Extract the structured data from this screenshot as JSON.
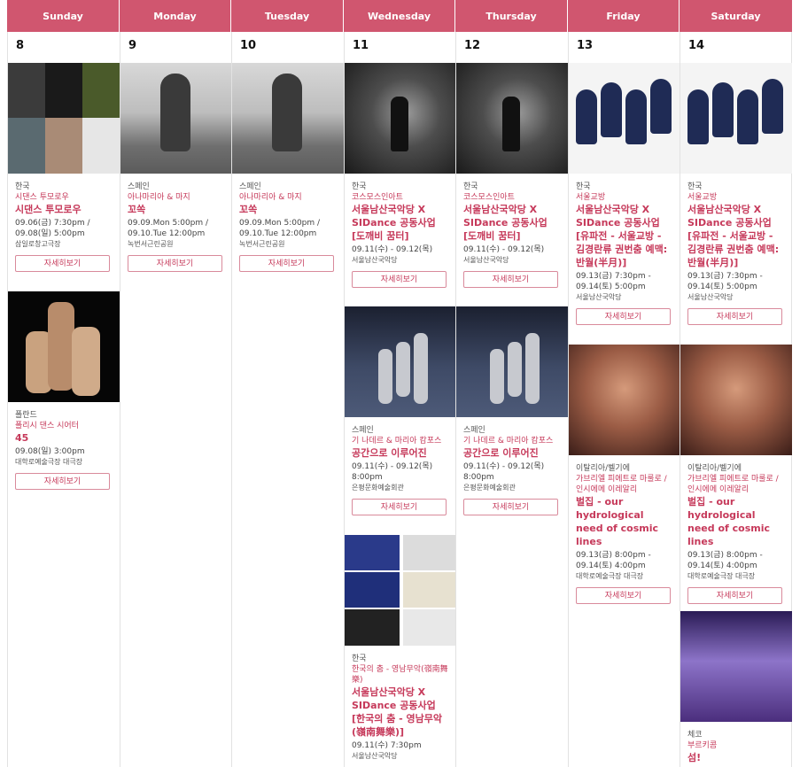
{
  "days": [
    {
      "name": "Sunday",
      "date": "8"
    },
    {
      "name": "Monday",
      "date": "9"
    },
    {
      "name": "Tuesday",
      "date": "10"
    },
    {
      "name": "Wednesday",
      "date": "11"
    },
    {
      "name": "Thursday",
      "date": "12"
    },
    {
      "name": "Friday",
      "date": "13"
    },
    {
      "name": "Saturday",
      "date": "14"
    }
  ],
  "button_label": "자세히보기",
  "events": {
    "sun1": {
      "country": "한국",
      "company": "시댄스 투모로우",
      "title": "시댄스 투모로우",
      "date": "09.06(금) 7:30pm / 09.08(일) 5:00pm",
      "venue": "삼일로창고극장"
    },
    "sun2": {
      "country": "폴란드",
      "company": "폴리시 댄스 시어터",
      "title": "45",
      "date": "09.08(일) 3:00pm",
      "venue": "대학로예술극장 대극장"
    },
    "mon1": {
      "country": "스페인",
      "company": "아나마리아 & 마지",
      "title": "꼬쏙",
      "date": "09.09.Mon 5:00pm / 09.10.Tue 12:00pm",
      "venue": "녹번서근린공원"
    },
    "tue1": {
      "country": "스페인",
      "company": "아나마리아 & 마지",
      "title": "꼬쏙",
      "date": "09.09.Mon 5:00pm / 09.10.Tue 12:00pm",
      "venue": "녹번서근린공원"
    },
    "wed1": {
      "country": "한국",
      "company": "코스모스인아트",
      "title": "서울남산국악당 X SIDance 공동사업 [도깨비 꿈터]",
      "date": "09.11(수) - 09.12(목)",
      "venue": "서울남산국악당"
    },
    "wed2": {
      "country": "스페인",
      "company": "기 나데르 & 마리아 캄포스",
      "title": "공간으로 이루어진",
      "date": "09.11(수) - 09.12(목) 8:00pm",
      "venue": "은평문화예술회관"
    },
    "wed3": {
      "country": "한국",
      "company": "한국의 춤 - 영남무악(嶺南舞樂)",
      "title": "서울남산국악당 X SIDance 공동사업 [한국의 춤 - 영남무악(嶺南舞樂)]",
      "date": "09.11(수) 7:30pm",
      "venue": "서울남산국악당"
    },
    "thu1": {
      "country": "한국",
      "company": "코스모스인아트",
      "title": "서울남산국악당 X SIDance 공동사업 [도깨비 꿈터]",
      "date": "09.11(수) - 09.12(목)",
      "venue": "서울남산국악당"
    },
    "thu2": {
      "country": "스페인",
      "company": "기 나데르 & 마리아 캄포스",
      "title": "공간으로 이루어진",
      "date": "09.11(수) - 09.12(목) 8:00pm",
      "venue": "은평문화예술회관"
    },
    "fri1": {
      "country": "한국",
      "company": "서울교방",
      "title": "서울남산국악당 X SIDance 공동사업 [유파전 - 서울교방 - 김경란류 권번춤 예맥: 반월(半月)]",
      "date": "09.13(금) 7:30pm - 09.14(토) 5:00pm",
      "venue": "서울남산국악당"
    },
    "fri2": {
      "country": "이탈리아/벨기에",
      "company": "가브리엘 피에트로 마룰로 / 인시에메 이레알리",
      "title": "벌집 - our hydrological need of cosmic lines",
      "date": "09.13(금) 8:00pm - 09.14(토) 4:00pm",
      "venue": "대학로예술극장 대극장"
    },
    "sat1": {
      "country": "한국",
      "company": "서울교방",
      "title": "서울남산국악당 X SIDance 공동사업 [유파전 - 서울교방 - 김경란류 권번춤 예맥: 반월(半月)]",
      "date": "09.13(금) 7:30pm - 09.14(토) 5:00pm",
      "venue": "서울남산국악당"
    },
    "sat2": {
      "country": "이탈리아/벨기에",
      "company": "가브리엘 피에트로 마룰로 / 인시에메 이레알리",
      "title": "벌집 - our hydrological need of cosmic lines",
      "date": "09.13(금) 8:00pm - 09.14(토) 4:00pm",
      "venue": "대학로예술극장 대극장"
    },
    "sat3": {
      "country": "체코",
      "company": "부르키콤",
      "title": "섬!"
    }
  }
}
